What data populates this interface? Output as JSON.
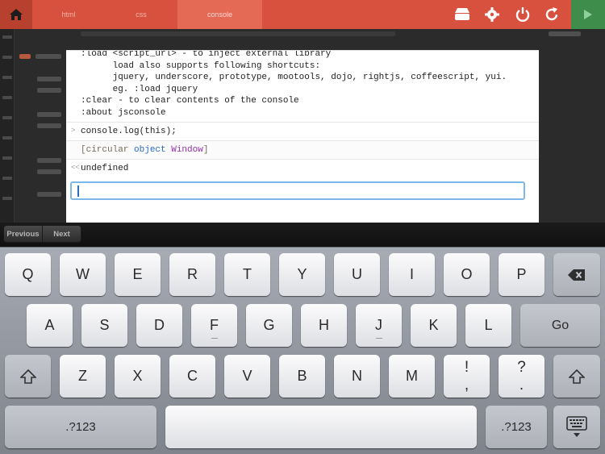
{
  "topbar": {
    "tabs": [
      "html",
      "css",
      "console"
    ],
    "active_tab": "console",
    "icons": [
      "home-icon",
      "deploy-icon",
      "settings-icon",
      "refresh-icon",
      "run-icon"
    ],
    "colors": {
      "bar": "#d8513f",
      "active": "#e56a56",
      "run": "#3f8d4b"
    }
  },
  "console": {
    "help_lines": [
      ":load <script_url> - to inject external library",
      "      load also supports following shortcuts:",
      "      jquery, underscore, prototype, mootools, dojo, rightjs, coffeescript, yui.",
      "      eg. :load jquery",
      ":clear - to clear contents of the console",
      ":about jsconsole"
    ],
    "input_prompt": ">",
    "input_command": "console.log(this);",
    "output_open": "[circular ",
    "output_keyword": "object",
    "output_class": "Window",
    "output_close": "]",
    "result_prompt": "<<",
    "result_value": "undefined",
    "field_value": ""
  },
  "accessory": {
    "previous": "Previous",
    "next": "Next"
  },
  "keyboard": {
    "row1": [
      "Q",
      "W",
      "E",
      "R",
      "T",
      "Y",
      "U",
      "I",
      "O",
      "P"
    ],
    "row2": [
      "A",
      "S",
      "D",
      "F",
      "G",
      "H",
      "J",
      "K",
      "L"
    ],
    "row3": [
      "Z",
      "X",
      "C",
      "V",
      "B",
      "N",
      "M"
    ],
    "row3_punct": [
      [
        "!",
        ","
      ],
      [
        "?",
        "."
      ]
    ],
    "go": "Go",
    "numbers_left": ".?123",
    "numbers_right": ".?123",
    "icons": [
      "backspace-icon",
      "shift-icon",
      "hide-keyboard-icon"
    ]
  }
}
